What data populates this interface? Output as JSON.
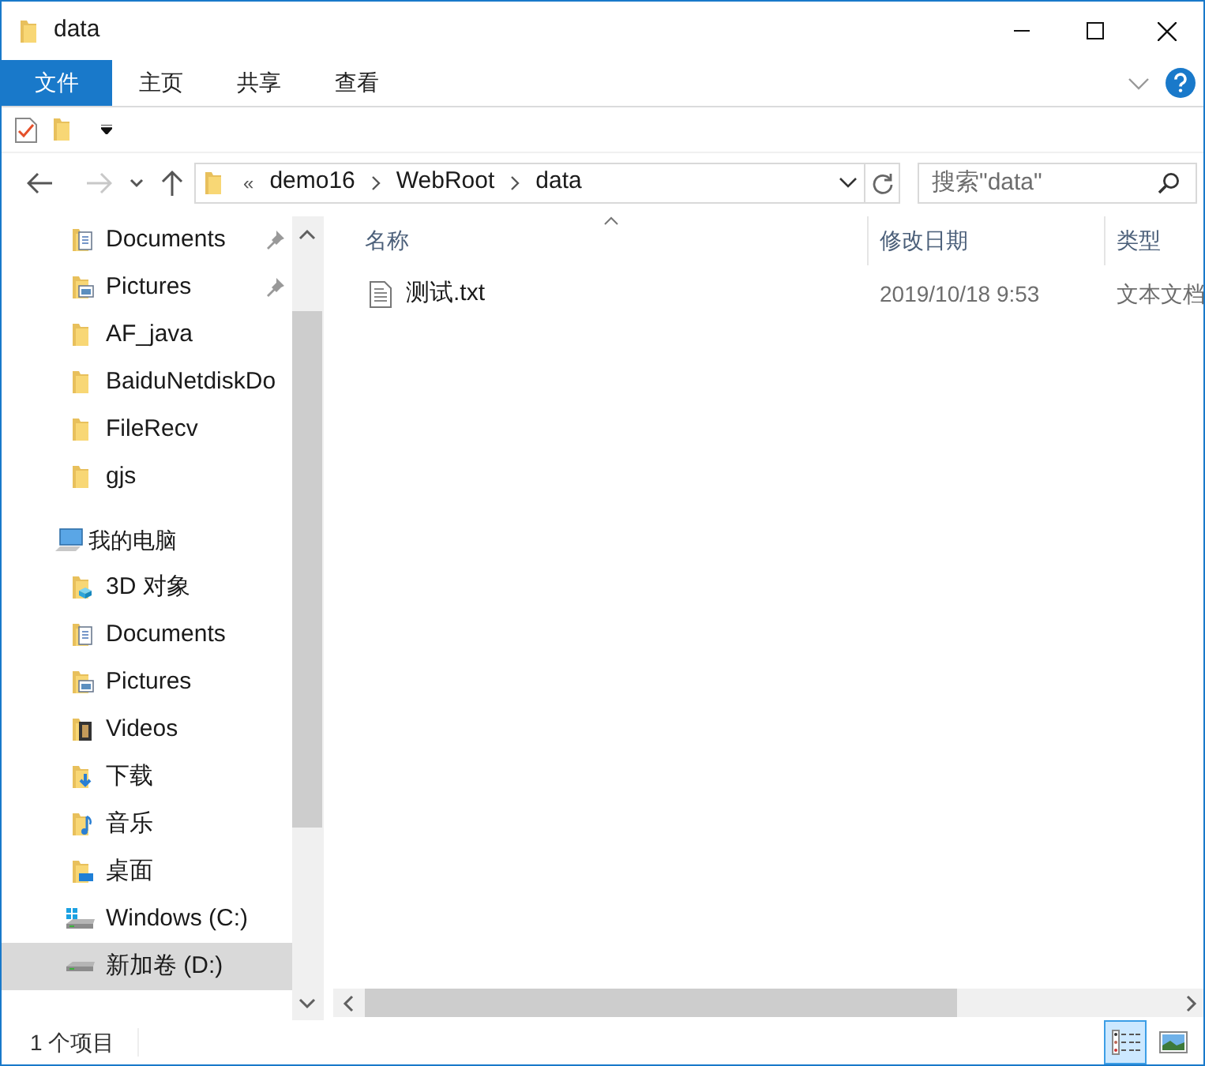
{
  "window": {
    "title": "data"
  },
  "ribbon_tabs": [
    {
      "label": "文件",
      "selected": true
    },
    {
      "label": "主页",
      "selected": false
    },
    {
      "label": "共享",
      "selected": false
    },
    {
      "label": "查看",
      "selected": false
    }
  ],
  "address": {
    "overflow": "«",
    "crumbs": [
      "demo16",
      "WebRoot",
      "data"
    ]
  },
  "search": {
    "placeholder": "搜索\"data\""
  },
  "nav": {
    "items": [
      {
        "label": "Documents",
        "kind": "documents",
        "pinned": true,
        "selected": false
      },
      {
        "label": "Pictures",
        "kind": "pictures",
        "pinned": true,
        "selected": false
      },
      {
        "label": "AF_java",
        "kind": "folder",
        "pinned": false,
        "selected": false
      },
      {
        "label": "BaiduNetdiskDo",
        "kind": "folder",
        "pinned": false,
        "selected": false
      },
      {
        "label": "FileRecv",
        "kind": "folder",
        "pinned": false,
        "selected": false
      },
      {
        "label": "gjs",
        "kind": "folder",
        "pinned": false,
        "selected": false
      }
    ],
    "this_pc": {
      "label": "我的电脑",
      "kind": "pc",
      "selected": false,
      "children": [
        {
          "label": "3D 对象",
          "kind": "objects3d",
          "selected": false
        },
        {
          "label": "Documents",
          "kind": "documents",
          "selected": false
        },
        {
          "label": "Pictures",
          "kind": "pictures",
          "selected": false
        },
        {
          "label": "Videos",
          "kind": "videos",
          "selected": false
        },
        {
          "label": "下载",
          "kind": "downloads",
          "selected": false
        },
        {
          "label": "音乐",
          "kind": "music",
          "selected": false
        },
        {
          "label": "桌面",
          "kind": "desktop",
          "selected": false
        },
        {
          "label": "Windows (C:)",
          "kind": "drive-windows",
          "selected": false
        },
        {
          "label": "新加卷 (D:)",
          "kind": "drive",
          "selected": true
        }
      ]
    }
  },
  "table": {
    "columns": [
      "名称",
      "修改日期",
      "类型"
    ],
    "rows": [
      {
        "name": "测试.txt",
        "modified": "2019/10/18 9:53",
        "type": "文本文档",
        "selected": false
      }
    ]
  },
  "status_bar": {
    "text": "1 个项目"
  },
  "view_buttons": [
    {
      "kind": "details",
      "selected": true
    },
    {
      "kind": "large-icons",
      "selected": false
    }
  ]
}
